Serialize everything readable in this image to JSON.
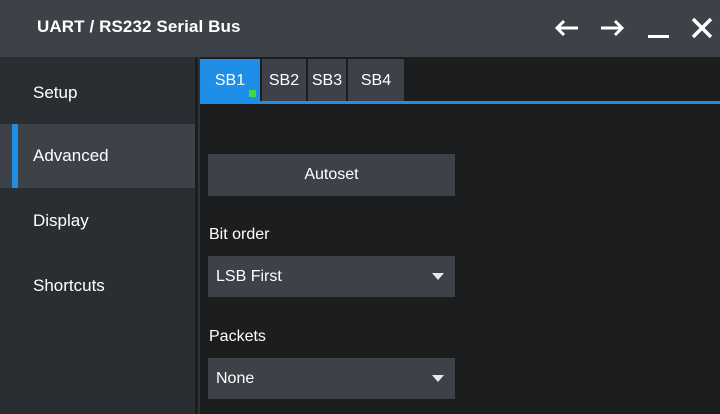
{
  "window": {
    "title": "UART / RS232 Serial Bus",
    "controls": [
      "back-arrow-icon",
      "forward-arrow-icon",
      "minimize-icon",
      "close-icon"
    ]
  },
  "sidebar": {
    "items": [
      {
        "label": "Setup",
        "active": false
      },
      {
        "label": "Advanced",
        "active": true
      },
      {
        "label": "Display",
        "active": false
      },
      {
        "label": "Shortcuts",
        "active": false
      }
    ]
  },
  "tabs": [
    {
      "label": "SB1",
      "active": true,
      "status_indicator": "green"
    },
    {
      "label": "SB2",
      "active": false
    },
    {
      "label": "SB3",
      "active": false
    },
    {
      "label": "SB4",
      "active": false
    }
  ],
  "main": {
    "autoset_label": "Autoset",
    "bit_order": {
      "label": "Bit order",
      "value": "LSB First"
    },
    "packets": {
      "label": "Packets",
      "value": "None"
    }
  },
  "colors": {
    "accent": "#1e8ee6",
    "status_green": "#3ddc3d",
    "titlebar": "#3c4248",
    "sidebar": "#2a2e32",
    "background": "#1b1d1f"
  }
}
